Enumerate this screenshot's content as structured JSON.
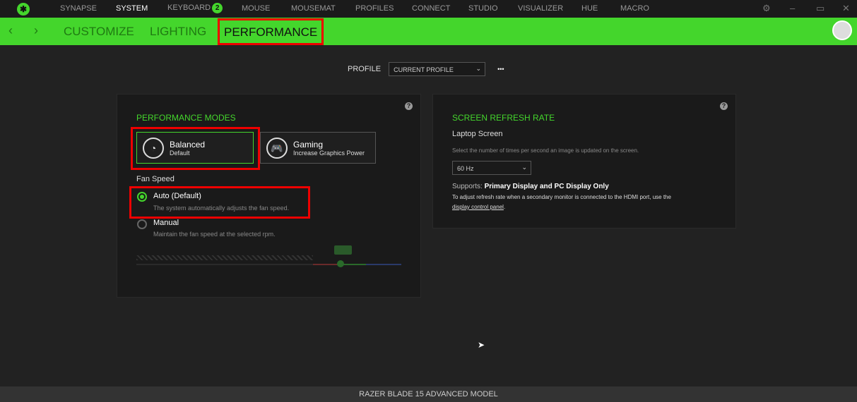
{
  "topnav": {
    "items": [
      "SYNAPSE",
      "SYSTEM",
      "KEYBOARD",
      "MOUSE",
      "MOUSEMAT",
      "PROFILES",
      "CONNECT",
      "STUDIO",
      "VISUALIZER",
      "HUE",
      "MACRO"
    ],
    "keyboard_badge": "2",
    "active": "SYSTEM"
  },
  "subnav": {
    "items": [
      "CUSTOMIZE",
      "LIGHTING",
      "PERFORMANCE"
    ],
    "active": "PERFORMANCE"
  },
  "profile": {
    "label": "PROFILE",
    "value": "CURRENT PROFILE",
    "more": "•••"
  },
  "performance": {
    "title": "PERFORMANCE MODES",
    "modes": [
      {
        "name": "Balanced",
        "sub": "Default",
        "selected": true
      },
      {
        "name": "Gaming",
        "sub": "Increase Graphics Power",
        "selected": false
      }
    ],
    "fan_label": "Fan Speed",
    "fan_options": [
      {
        "label": "Auto (Default)",
        "desc": "The system automatically adjusts the fan speed.",
        "selected": true
      },
      {
        "label": "Manual",
        "desc": "Maintain the fan speed at the selected rpm.",
        "selected": false
      }
    ]
  },
  "refresh": {
    "title": "SCREEN REFRESH RATE",
    "subtitle": "Laptop Screen",
    "desc": "Select the number of times per second an image is updated on the screen.",
    "value": "60 Hz",
    "supports_label": "Supports:",
    "supports_value": "Primary Display and PC Display Only",
    "note": "To adjust refresh rate when a secondary monitor is connected to the HDMI port, use the",
    "link": "display control panel",
    "link_end": "."
  },
  "footer": "RAZER BLADE 15 ADVANCED MODEL",
  "colors": {
    "accent": "#44d62c",
    "highlight": "#e00000"
  }
}
